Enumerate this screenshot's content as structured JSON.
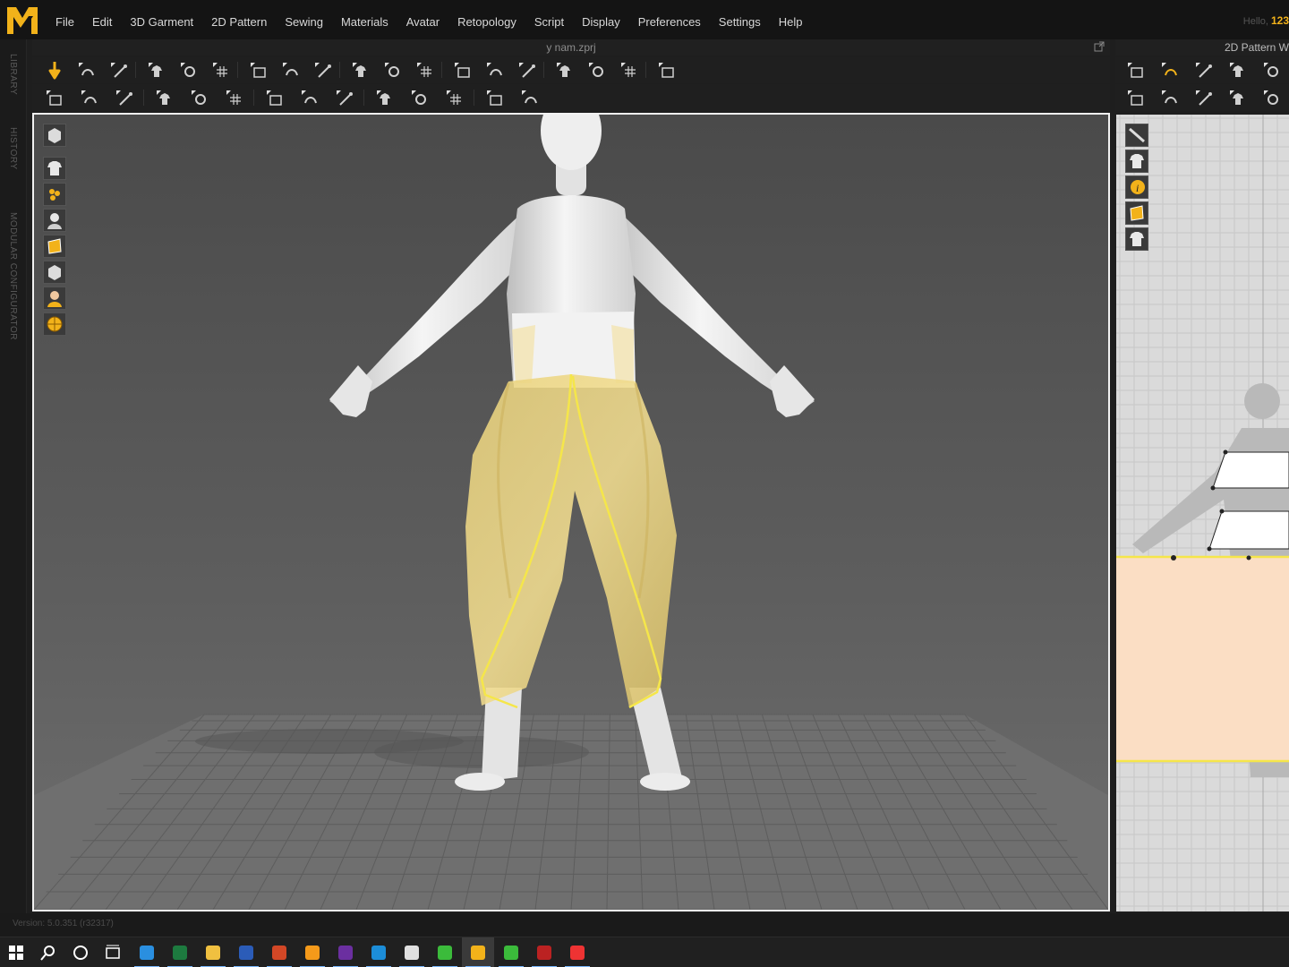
{
  "app": {
    "logo_icon": "marvelous-designer-logo-icon",
    "accent": "#f2b21a"
  },
  "menu": [
    "File",
    "Edit",
    "3D Garment",
    "2D Pattern",
    "Sewing",
    "Materials",
    "Avatar",
    "Retopology",
    "Script",
    "Display",
    "Preferences",
    "Settings",
    "Help"
  ],
  "user": {
    "greeting": "Hello,",
    "name": "123"
  },
  "side_tabs": [
    "LIBRARY",
    "HISTORY",
    "MODULAR CONFIGURATOR"
  ],
  "window3d": {
    "title": "y nam.zprj",
    "toolbar_row1": [
      "simulation-icon",
      "select-move-icon",
      "transform-pattern-icon",
      "fold-arrangement-icon",
      "fold-icon",
      "unfold-icon",
      "line-icon",
      "garment-edit-icon",
      "edit-points-icon",
      "edit-curvature-icon",
      "tack-icon",
      "shirt-icon",
      "pants-icon",
      "avatar-front-icon",
      "avatar-back-icon",
      "measure-icon",
      "ruler-icon",
      "grid-icon",
      "uv-grid-icon"
    ],
    "toolbar_row2": [
      "walk-icon",
      "pin-icon",
      "pin-box-icon",
      "brush-icon",
      "shrink-icon",
      "puckering-icon",
      "zipper-icon",
      "button-icon",
      "buttonhole-icon",
      "button-snap-icon",
      "trim-icon",
      "iron-icon",
      "flat-icon",
      "steam-icon"
    ],
    "view_tools": [
      "3d-view-icon",
      "garment-display-icon",
      "texture-display-icon",
      "avatar-display-icon",
      "fabric-display-icon",
      "pattern-display-icon",
      "avatar-skin-icon",
      "environment-icon"
    ]
  },
  "window2d": {
    "title": "2D Pattern W",
    "toolbar_row1": [
      "select-pattern-icon",
      "edit-pattern-icon",
      "transform-icon",
      "rectangle-icon",
      "polygon-icon"
    ],
    "toolbar_row2": [
      "sewing-icon",
      "segment-sewing-icon",
      "free-sewing-icon",
      "check-sewing-icon",
      "more-icon"
    ],
    "view_tools": [
      "hide-brush-icon",
      "garment-eye-icon",
      "info-icon",
      "fabric-icon",
      "lock-garment-icon"
    ]
  },
  "colors": {
    "pattern_fill": "#fbdec4",
    "selected_line": "#f5e64a",
    "garment": "#ecd27e"
  },
  "status": {
    "version": "Version: 5.0.351 (r32317)"
  },
  "taskbar": [
    "windows-start-icon",
    "search-icon",
    "cortana-icon",
    "task-view-icon",
    "edge-icon",
    "excel-icon",
    "file-explorer-icon",
    "word-icon",
    "powerpoint-icon",
    "search-app-icon",
    "premiere-icon",
    "photoshop-icon",
    "marvelous-helper-icon",
    "vpn-icon",
    "marvelous-designer-taskbar-icon",
    "recorder-icon",
    "winrar-icon",
    "video-icon"
  ]
}
